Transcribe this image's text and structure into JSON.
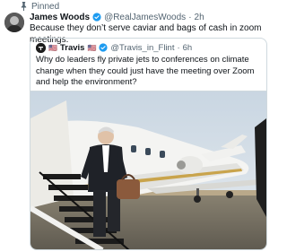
{
  "pinned_label": "Pinned",
  "tweet": {
    "author_name": "James Woods",
    "author_handle": "@RealJamesWoods",
    "separator": "·",
    "time": "2h",
    "text": "Because they don’t serve caviar and bags of cash in zoom meetings."
  },
  "quote": {
    "author_name": "Travis",
    "author_handle": "@Travis_in_Flint",
    "separator": "·",
    "time": "6h",
    "text": "Why do leaders fly private jets to conferences on climate change when they could just have the meeting over Zoom and help the environment?"
  },
  "icons": {
    "pin": "pin-icon",
    "verified": "verified-badge-icon",
    "flag": "us-flag-icon"
  },
  "colors": {
    "verified": "#1d9bf0",
    "secondary_text": "#536471",
    "border": "#cfd9de"
  }
}
